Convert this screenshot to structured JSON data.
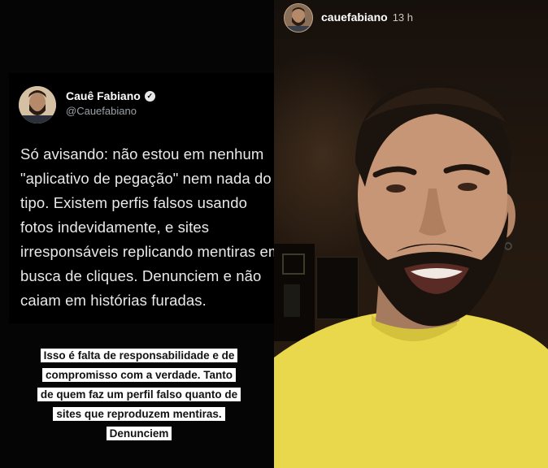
{
  "left_story": {
    "tweet": {
      "display_name": "Cauê Fabiano",
      "handle": "@Cauefabiano",
      "text": "Só avisando: não estou em nenhum\n\"aplicativo de pegação\" nem nada do\ntipo. Existem perfis falsos usando\nfotos indevidamente, e sites\nirresponsáveis replicando mentiras em\nbusca de cliques. Denunciem e não\ncaiam em histórias furadas."
    },
    "caption_lines": [
      "Isso é falta de responsabilidade e de",
      "compromisso com a verdade.  Tanto",
      "de quem faz um perfil falso quanto de",
      "sites que reproduzem mentiras.",
      "Denunciem"
    ]
  },
  "right_story": {
    "username": "cauefabiano",
    "time": "13 h"
  },
  "icons": {
    "verified": "verified-badge-icon"
  },
  "colors": {
    "shirt": "#e9d84c",
    "beard": "#1a120c",
    "caption_bg": "#ffffff",
    "background": "#050505"
  }
}
